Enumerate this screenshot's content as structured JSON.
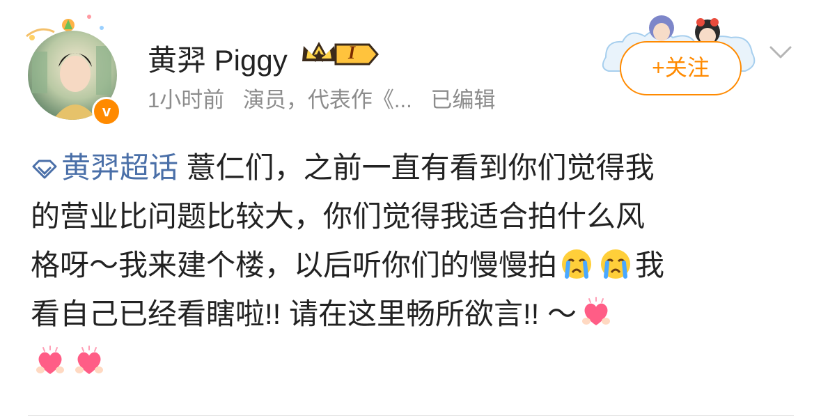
{
  "post": {
    "author": {
      "name": "黄羿 Piggy",
      "verified_mark": "v",
      "vip_level": "I"
    },
    "meta": {
      "time": "1小时前",
      "bio": "演员，代表作《...",
      "edited": "已编辑"
    },
    "follow_button": {
      "label": "+关注"
    },
    "content": {
      "topic": "黄羿超话",
      "line1_after_topic": " 薏仁们，之前一直有看到你们觉得我",
      "line2": "的营业比问题比较大，你们觉得我适合拍什么风",
      "line3_before_emoji": "格呀～我来建个楼，以后听你们的慢慢拍",
      "line3_after_emoji": "我",
      "line4": "看自己已经看瞎啦!! 请在这里畅所欲言!! ～"
    },
    "icons": {
      "topic": "topic-diamond-icon",
      "crying_emoji": "crying-face-emoji",
      "heart_emoji": "heart-hands-emoji",
      "more": "chevron-down-icon"
    },
    "colors": {
      "accent": "#ff8a00",
      "topic": "#4a6fa8",
      "text": "#222222",
      "meta": "#8c8c8c"
    }
  }
}
